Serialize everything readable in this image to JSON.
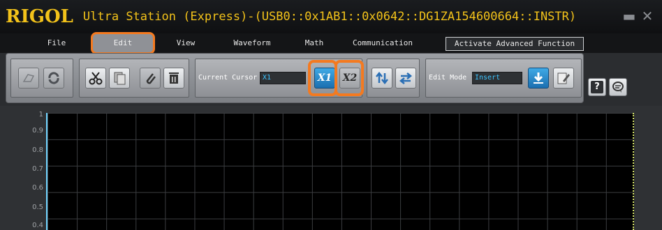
{
  "titlebar": {
    "logo": "RIGOL",
    "title": "Ultra Station (Express)-(USB0::0x1AB1::0x0642::DG1ZA154600664::INSTR)",
    "minimize_glyph": "▬",
    "close_glyph": "✕"
  },
  "menu": {
    "items": [
      "File",
      "Edit",
      "View",
      "Waveform",
      "Math",
      "Communication"
    ],
    "active": "Edit",
    "advanced_button": "Activate Advanced Function"
  },
  "toolbar": {
    "cursor_label": "Current Cursor",
    "cursor_value": "X1",
    "edit_mode_label": "Edit Mode",
    "edit_mode_value": "Insert",
    "x1_label": "X1",
    "x2_label": "X2"
  },
  "icons": {
    "undo": "undo-icon",
    "redo": "redo-icon",
    "cut": "scissors-icon",
    "copy": "copy-icon",
    "attach": "paperclip-icon",
    "delete": "trash-icon",
    "cursor_x1": "cursor-x1-icon",
    "cursor_x2": "cursor-x2-icon",
    "swap_vertical": "swap-vertical-icon",
    "swap_horizontal": "swap-horizontal-icon",
    "download": "download-icon",
    "edit": "edit-icon",
    "help": "help-icon",
    "chat": "chat-icon"
  },
  "plot": {
    "y_ticks": [
      "1",
      "0.9",
      "0.8",
      "0.7",
      "0.6",
      "0.5",
      "0.4"
    ]
  },
  "colors": {
    "accent_orange": "#f47a20",
    "title_yellow": "#f2c21a",
    "field_text": "#3cc4ff"
  }
}
